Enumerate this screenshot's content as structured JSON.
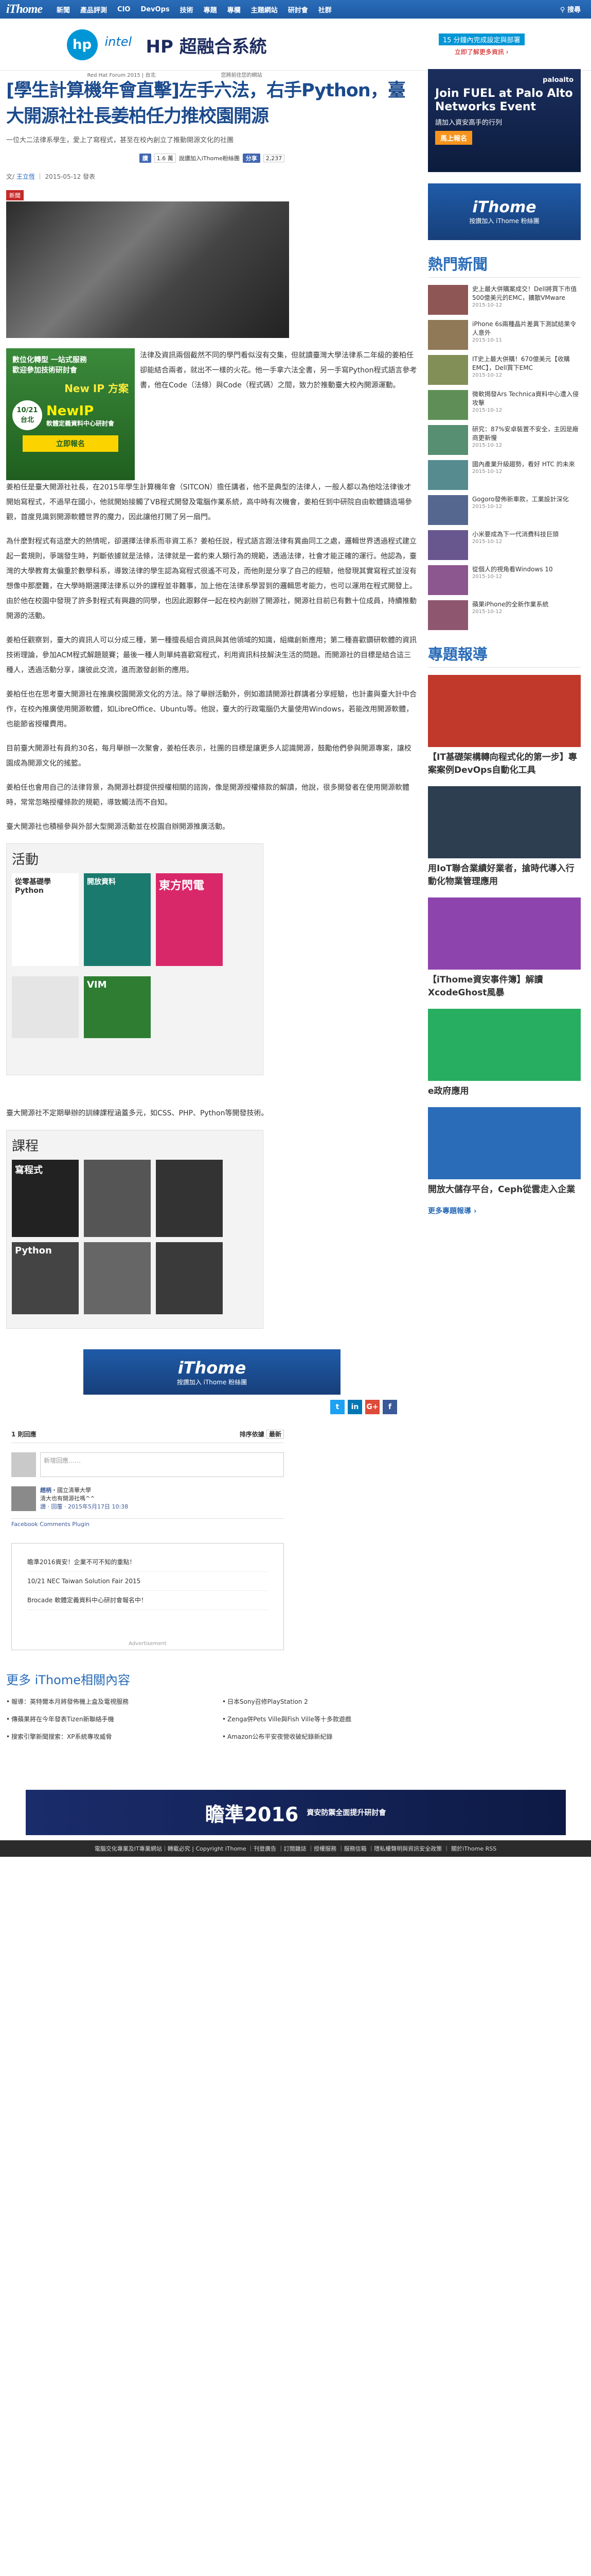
{
  "nav": {
    "logo": "iThome",
    "items": [
      "新聞",
      "產品評測",
      "CIO",
      "DevOps",
      "技術",
      "專題",
      "專欄",
      "主題網站",
      "研討會",
      "社群"
    ],
    "search": "搜尋"
  },
  "top_ad": {
    "brand": "HP 超融合系統",
    "tag": "15 分鐘內完成設定與部署",
    "link": "立即了解更多資訊 ›",
    "sponsor": "Red Hat Forum 2015 | 台北",
    "notice": "您將前往您的網站"
  },
  "article": {
    "title": "[學生計算機年會直擊]左手六法，右手Python，臺大開源社社長姜柏任力推校園開源",
    "subtitle": "一位大二法律系學生，愛上了寫程式，甚至在校內創立了推動開源文化的社團",
    "share": {
      "like": "讚",
      "like_count": "1.6 萬",
      "share": "分享",
      "share_count": "2,237",
      "text": "說讚加入iThome粉絲團"
    },
    "meta": {
      "author": "王立恆",
      "sep": "｜",
      "date": "2015-05-12 發表"
    },
    "tag": "新聞",
    "left_ad": {
      "line1": "數位化轉型 一站式服務",
      "line2": "歡迎參加技術研討會",
      "event": "New IP 方案",
      "date": "10/21 台北",
      "title": "NewIP",
      "desc": "軟體定義資料中心研討會",
      "cta": "立即報名"
    },
    "paragraphs": [
      "法律及資訊兩個截然不同的學門看似沒有交集，但就讀臺灣大學法律系二年級的姜柏任卻能結合兩者，就出不一樣的火花。他一手拿六法全書，另一手寫Python程式語言參考書，他在Code（法條）與Code（程式碼）之間，致力於推動臺大校內開源運動。",
      "姜柏任是臺大開源社社長，在2015年學生計算機年會（SITCON）擔任講者，他不是典型的法律人，一般人都以為他唸法律後才開始寫程式，不過早在國小，他就開始接觸了VB程式開發及電腦作業系統，高中時有次機會，姜柏任到中研院自由軟體鑄造場參觀，首度見識到開源軟體世界的魔力，因此讓他打開了另一扇門。",
      "為什麼對程式有這麼大的熱情呢，卻選擇法律系而非資工系？姜柏任說，程式語言跟法律有異曲同工之處，邏輯世界透過程式建立起一套規則，爭端發生時，判斷依據就是法條，法律就是一套約束人類行為的規範，透過法律，社會才能正確的運行。他認為，臺灣的大學教育太偏重於數學科系，導致法律的學生認為寫程式很遙不可及，而他則是分享了自己的經驗，他發現其實寫程式並沒有想像中那麼難，在大學時期選擇法律系以外的課程並非難事，加上他在法律系學習到的邏輯思考能力，也可以運用在程式開發上。由於他在校園中發現了許多對程式有興趣的同學，也因此跟夥伴一起在校內創辦了開源社，開源社目前已有數十位成員，持續推動開源的活動。",
      "姜柏任觀察到，臺大的資訊人可以分成三種，第一種擅長組合資訊與其他領域的知識，組織創新應用；第二種喜歡鑽研軟體的資訊技術理論，參加ACM程式解題競賽；最後一種人則單純喜歡寫程式，利用資訊科技解決生活的問題。而開源社的目標是結合這三種人，透過活動分享，讓彼此交流，進而激發創新的應用。",
      "姜柏任也在思考臺大開源社在推廣校園開源文化的方法。除了舉辦活動外，例如邀請開源社群講者分享經驗，也計畫與臺大計中合作，在校內推廣使用開源軟體，如LibreOffice、Ubuntu等。他說，臺大的行政電腦仍大量使用Windows，若能改用開源軟體，也能節省授權費用。",
      "目前臺大開源社有員約30名，每月舉辦一次聚會，姜柏任表示，社團的目標是讓更多人認識開源，鼓勵他們參與開源專案，讓校園成為開源文化的搖籃。",
      "姜柏任也會用自己的法律背景，為開源社群提供授權相關的諮詢，像是開源授權條款的解讀，他說，很多開發者在使用開源軟體時，常常忽略授權條款的規範，導致觸法而不自知。"
    ],
    "caption1": "臺大開源社也積極參與外部大型開源活動並在校園自辦開源推廣活動。",
    "img1": {
      "title": "活動",
      "books": [
        "從零基礎學Python",
        "開放資料",
        "東方閃電",
        "VIM"
      ]
    },
    "caption2": "臺大開源社不定期舉辦的訓練課程涵蓋多元，如CSS、PHP、Python等開發技術。",
    "img2": {
      "title": "課程",
      "books": [
        "寫程式",
        "Python"
      ]
    },
    "banner": {
      "title": "iThome",
      "sub": "按讚加入 iThome 粉絲團"
    },
    "comments": {
      "count": "1 則回應",
      "sort_label": "排序依據",
      "sort_value": "最新",
      "placeholder": "新增回應……",
      "name": "趙柄",
      "org": "・國立清華大學",
      "text": "清大也有開源社嗎^^",
      "actions": "讚 · 回覆 · 2015年5月17日 10:38",
      "plugin": "Facebook Comments Plugin"
    },
    "promo": {
      "items": [
        "瞻準2016資安！企業不可不知的重點！",
        "10/21 NEC Taiwan Solution Fair 2015",
        "Brocade 軟體定義資料中心研討會報名中！"
      ],
      "adv": "Advertisement"
    },
    "more": {
      "title": "更多 iThome相關內容",
      "items": [
        "報導：英特爾本月將發佈機上盒及電視服務",
        "日本Sony召修PlayStation 2",
        "傳蘋果將在今年發表Tizen新聯絡手機",
        "Zenga併Pets Ville與Fish Ville等十多款遊戲",
        "搜索引擎新聞搜索：XP系統專攻威脅",
        "Amazon公布平安夜營收破紀錄新紀錄"
      ]
    }
  },
  "sidebar": {
    "ad": {
      "brand": "paloalto",
      "line1": "Join FUEL at Palo Alto Networks Event",
      "line2": "請加入資安高手的行列",
      "cta": "馬上報名"
    },
    "banner": {
      "title": "iThome",
      "sub": "按讚加入 iThome 粉絲團"
    },
    "hot_title": "熱門新聞",
    "hot": [
      {
        "t": "史上最大併購案成交！Dell將買下市值500億美元的EMC，擴散VMware",
        "d": "2015-10-12"
      },
      {
        "t": "iPhone 6s兩種晶片差異下測試結果令人意外",
        "d": "2015-10-11"
      },
      {
        "t": "IT史上最大併購！670億美元【收購EMC】，Dell買下EMC",
        "d": "2015-10-12"
      },
      {
        "t": "微軟揭發Ars Technica資料中心遭入侵攻擊",
        "d": "2015-10-12"
      },
      {
        "t": "研究：87%安卓裝置不安全，主因是廠商更新慢",
        "d": "2015-10-12"
      },
      {
        "t": "國內產業升級趨勢，看好 HTC 的未來",
        "d": "2015-10-12"
      },
      {
        "t": "Gogoro發佈新車款，工業設計深化",
        "d": "2015-10-12"
      },
      {
        "t": "小米要成為下一代消費科技巨頭",
        "d": "2015-10-12"
      },
      {
        "t": "從個人的視角看Windows 10",
        "d": "2015-10-12"
      },
      {
        "t": "蘋果iPhone的全新作業系統",
        "d": "2015-10-12"
      }
    ],
    "rep_title": "專題報導",
    "reports": [
      {
        "t": "【IT基礎架構轉向程式化的第一步】專案案例DevOps自動化工具"
      },
      {
        "t": "用IoT聯合業績好業者，搶時代導入行動化物業管理應用"
      },
      {
        "t": "【iThome資安事件簿】解讀XcodeGhost風暴"
      },
      {
        "t": "e政府應用"
      },
      {
        "t": "開放大儲存平台，Ceph從雲走入企業"
      }
    ],
    "more": "更多專題報導 ›"
  },
  "footer_ad": {
    "title": "瞻準2016",
    "sub": "資安防禦全面提升研討會"
  },
  "footer": "電腦交化專業及IT專業網站｜轉載必究 | Copyright iThome ｜刊登廣告 ｜訂閱雜誌 ｜授權服務 ｜服務信箱 ｜隱私權聲明與資訊安全政策 ｜ 關於iThome RSS"
}
